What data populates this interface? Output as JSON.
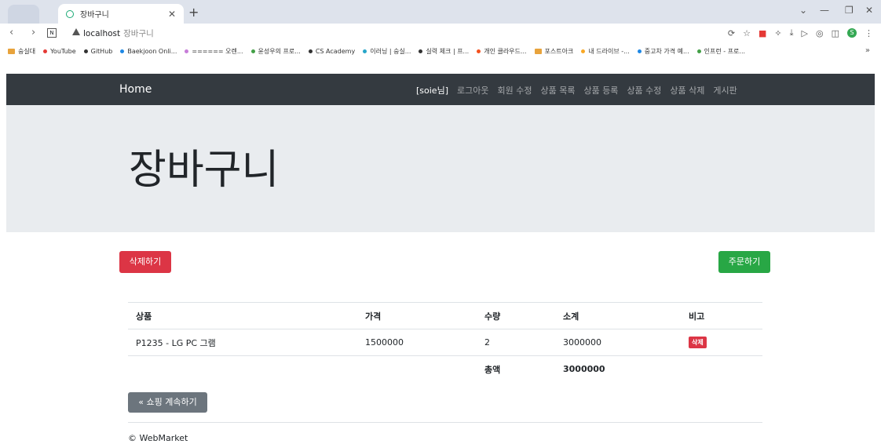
{
  "browser": {
    "tab_title": "장바구니",
    "url_host": "localhost",
    "url_path": "장바구니",
    "bookmarks": [
      {
        "label": "숭실대",
        "kind": "folder",
        "color": "#e8a33c"
      },
      {
        "label": "YouTube",
        "kind": "dot",
        "color": "#e53935"
      },
      {
        "label": "GitHub",
        "kind": "dot",
        "color": "#333333"
      },
      {
        "label": "Baekjoon Onli...",
        "kind": "dot",
        "color": "#1e88e5"
      },
      {
        "label": "====== 오렌...",
        "kind": "dot",
        "color": "#c77dd8"
      },
      {
        "label": "윤성우의 프로...",
        "kind": "dot",
        "color": "#43a047"
      },
      {
        "label": "CS Academy",
        "kind": "dot",
        "color": "#333333"
      },
      {
        "label": "이러닝 | 숭실...",
        "kind": "dot",
        "color": "#26a6c9"
      },
      {
        "label": "실력 체크 | 프...",
        "kind": "dot",
        "color": "#333333"
      },
      {
        "label": "개인 클라우드...",
        "kind": "dot",
        "color": "#f4511e"
      },
      {
        "label": "포스트아크",
        "kind": "folder",
        "color": "#e8a33c"
      },
      {
        "label": "내 드라이브 -...",
        "kind": "dot",
        "color": "#f9a825"
      },
      {
        "label": "중고차 가격 예...",
        "kind": "dot",
        "color": "#1e88e5"
      },
      {
        "label": "인프런 - 프로...",
        "kind": "dot",
        "color": "#43a047"
      }
    ]
  },
  "navbar": {
    "brand": "Home",
    "user": "[soie님]",
    "links": [
      "로그아웃",
      "회원 수정",
      "상품 목록",
      "상품 등록",
      "상품 수정",
      "상품 삭제",
      "게시판"
    ]
  },
  "jumbotron": {
    "title": "장바구니"
  },
  "actions": {
    "delete_label": "삭제하기",
    "order_label": "주문하기"
  },
  "cart": {
    "headers": [
      "상품",
      "가격",
      "수량",
      "소계",
      "비고"
    ],
    "rows": [
      {
        "product": "P1235 - LG PC 그램",
        "price": "1500000",
        "qty": "2",
        "subtotal": "3000000",
        "remark": "삭제"
      }
    ],
    "total_label": "총액",
    "total_value": "3000000"
  },
  "continue_label": "« 쇼핑 계속하기",
  "footer": "© WebMarket",
  "colors": {
    "navbar": "#343a40",
    "danger": "#dc3545",
    "success": "#28a745",
    "secondary": "#6c757d",
    "jumbotron": "#e9ecef"
  }
}
